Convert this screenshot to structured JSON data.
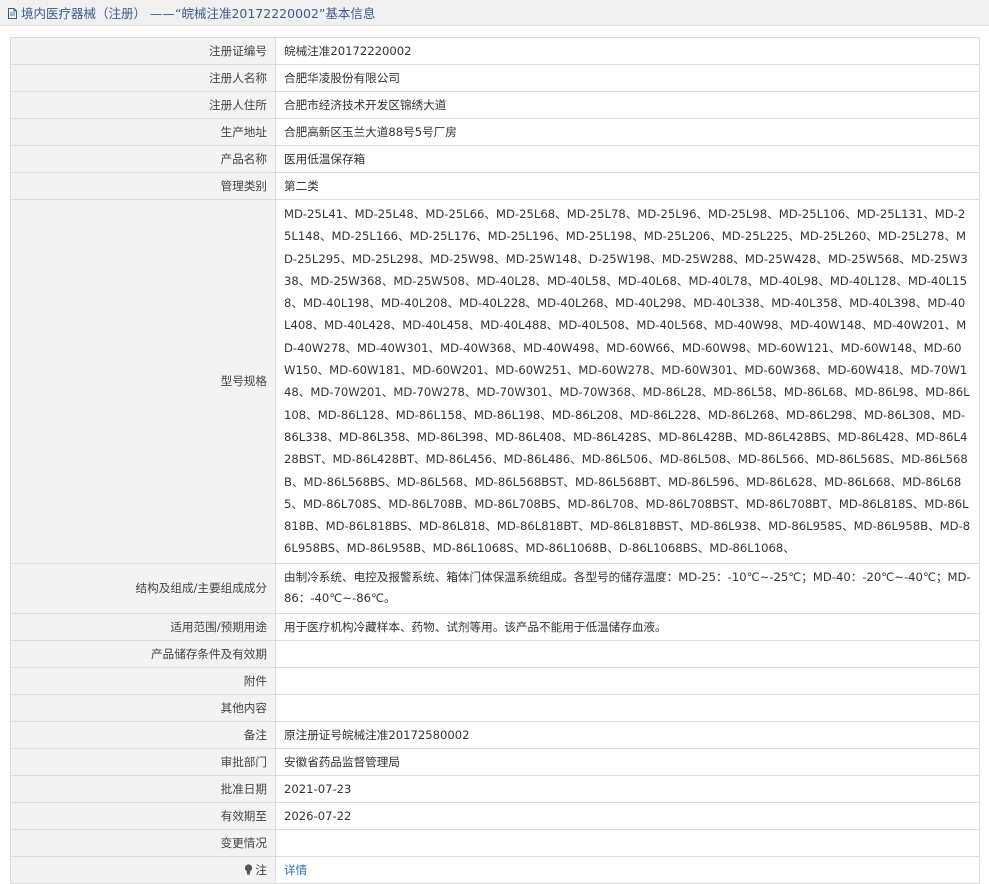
{
  "header": {
    "title": "境内医疗器械（注册）  ——“皖械注准20172220002”基本信息"
  },
  "rows": [
    {
      "key": "reg-no",
      "label": "注册证编号",
      "value": "皖械注准20172220002"
    },
    {
      "key": "registrant-name",
      "label": "注册人名称",
      "value": "合肥华凌股份有限公司"
    },
    {
      "key": "registrant-address",
      "label": "注册人住所",
      "value": "合肥市经济技术开发区锦绣大道"
    },
    {
      "key": "production-address",
      "label": "生产地址",
      "value": "合肥高新区玉兰大道88号5号厂房"
    },
    {
      "key": "product-name",
      "label": "产品名称",
      "value": "医用低温保存箱"
    },
    {
      "key": "management-class",
      "label": "管理类别",
      "value": "第二类"
    },
    {
      "key": "model-spec",
      "label": "型号规格",
      "value": "MD-25L41、MD-25L48、MD-25L66、MD-25L68、MD-25L78、MD-25L96、MD-25L98、MD-25L106、MD-25L131、MD-25L148、MD-25L166、MD-25L176、MD-25L196、MD-25L198、MD-25L206、MD-25L225、MD-25L260、MD-25L278、MD-25L295、MD-25L298、MD-25W98、MD-25W148、D-25W198、MD-25W288、MD-25W428、MD-25W568、MD-25W338、MD-25W368、MD-25W508、MD-40L28、MD-40L58、MD-40L68、MD-40L78、MD-40L98、MD-40L128、MD-40L158、MD-40L198、MD-40L208、MD-40L228、MD-40L268、MD-40L298、MD-40L338、MD-40L358、MD-40L398、MD-40L408、MD-40L428、MD-40L458、MD-40L488、MD-40L508、MD-40L568、MD-40W98、MD-40W148、MD-40W201、MD-40W278、MD-40W301、MD-40W368、MD-40W498、MD-60W66、MD-60W98、MD-60W121、MD-60W148、MD-60W150、MD-60W181、MD-60W201、MD-60W251、MD-60W278、MD-60W301、MD-60W368、MD-60W418、MD-70W148、MD-70W201、MD-70W278、MD-70W301、MD-70W368、MD-86L28、MD-86L58、MD-86L68、MD-86L98、MD-86L108、MD-86L128、MD-86L158、MD-86L198、MD-86L208、MD-86L228、MD-86L268、MD-86L298、MD-86L308、MD-86L338、MD-86L358、MD-86L398、MD-86L408、MD-86L428S、MD-86L428B、MD-86L428BS、MD-86L428、MD-86L428BST、MD-86L428BT、MD-86L456、MD-86L486、MD-86L506、MD-86L508、MD-86L566、MD-86L568S、MD-86L568B、MD-86L568BS、MD-86L568、MD-86L568BST、MD-86L568BT、MD-86L596、MD-86L628、MD-86L668、MD-86L685、MD-86L708S、MD-86L708B、MD-86L708BS、MD-86L708、MD-86L708BST、MD-86L708BT、MD-86L818S、MD-86L818B、MD-86L818BS、MD-86L818、MD-86L818BT、MD-86L818BST、MD-86L938、MD-86L958S、MD-86L958B、MD-86L958BS、MD-86L958B、MD-86L1068S、MD-86L1068B、D-86L1068BS、MD-86L1068、"
    },
    {
      "key": "structure",
      "label": "结构及组成/主要组成成分",
      "value": "由制冷系统、电控及报警系统、箱体门体保温系统组成。各型号的储存温度：MD-25：-10℃~-25℃；MD-40：-20℃~-40℃；MD-86：-40℃~-86℃。"
    },
    {
      "key": "intended-use",
      "label": "适用范围/预期用途",
      "value": "用于医疗机构冷藏样本、药物、试剂等用。该产品不能用于低温储存血液。"
    },
    {
      "key": "storage",
      "label": "产品储存条件及有效期",
      "value": ""
    },
    {
      "key": "attachment",
      "label": "附件",
      "value": ""
    },
    {
      "key": "other",
      "label": "其他内容",
      "value": ""
    },
    {
      "key": "remarks",
      "label": "备注",
      "value": "原注册证号皖械注准20172580002"
    },
    {
      "key": "approval-dept",
      "label": "审批部门",
      "value": "安徽省药品监督管理局"
    },
    {
      "key": "approval-date",
      "label": "批准日期",
      "value": "2021-07-23"
    },
    {
      "key": "valid-until",
      "label": "有效期至",
      "value": "2026-07-22"
    },
    {
      "key": "changes",
      "label": "变更情况",
      "value": ""
    }
  ],
  "note": {
    "label": "注",
    "link_text": "详情"
  },
  "colors": {
    "header_text": "#3a5c8c",
    "label_bg": "#f3f3f3",
    "border": "#dcdcdc",
    "link": "#2c6fb5"
  }
}
